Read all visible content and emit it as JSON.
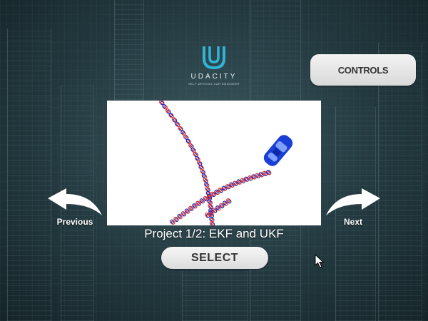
{
  "logo": {
    "wordmark": "UDACITY",
    "subtitle": "SELF-DRIVING CAR ENGINEER",
    "icon": "udacity-u-icon",
    "color": "#2fb5d5"
  },
  "controls_button": {
    "label": "CONTROLS"
  },
  "project": {
    "title": "Project 1/2: EKF and UKF",
    "preview_image": "car-tracking-preview",
    "car_color": "#1a3fd6",
    "marker_colors": {
      "measurement": "#e03030",
      "estimate": "#2a2ab0"
    }
  },
  "select_button": {
    "label": "SELECT"
  },
  "navigation": {
    "previous_label": "Previous",
    "next_label": "Next",
    "previous_icon": "curved-arrow-left-icon",
    "next_icon": "curved-arrow-right-icon"
  },
  "colors": {
    "button_bg": "#e6e6e6",
    "button_text": "#333333",
    "caption_text": "#ffffff"
  }
}
